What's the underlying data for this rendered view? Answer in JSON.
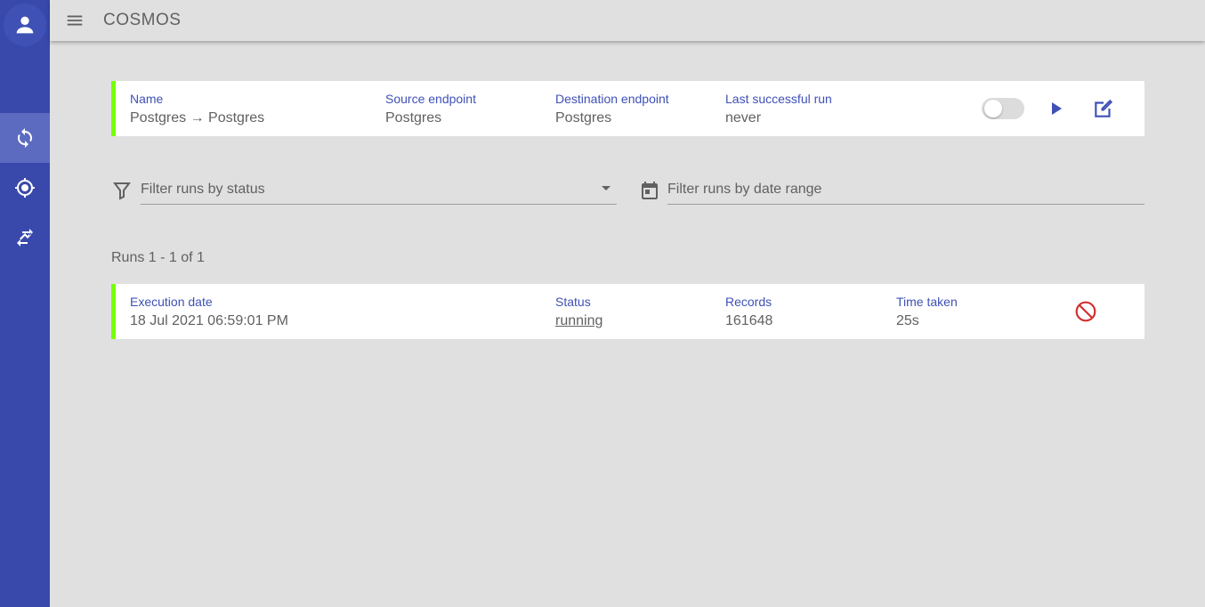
{
  "app": {
    "title": "COSMOS"
  },
  "sidebar": {
    "items": [
      {
        "name": "sync",
        "icon": "sync-icon",
        "active": true
      },
      {
        "name": "crosshair",
        "icon": "crosshair-icon",
        "active": false
      },
      {
        "name": "transfer",
        "icon": "transfer-icon",
        "active": false
      }
    ]
  },
  "transfer": {
    "name_label": "Name",
    "name_value": "Postgres → Postgres",
    "source_label": "Source endpoint",
    "source_value": "Postgres",
    "destination_label": "Destination endpoint",
    "destination_value": "Postgres",
    "last_run_label": "Last successful run",
    "last_run_value": "never",
    "enabled": false
  },
  "filters": {
    "status_placeholder": "Filter runs by status",
    "date_placeholder": "Filter runs by date range"
  },
  "runs": {
    "count_text": "Runs 1 - 1 of 1",
    "headers": {
      "execution_date": "Execution date",
      "status": "Status",
      "records": "Records",
      "time_taken": "Time taken"
    },
    "rows": [
      {
        "execution_date": "18 Jul 2021 06:59:01 PM",
        "status": "running",
        "records": "161648",
        "time_taken": "25s"
      }
    ]
  },
  "colors": {
    "sidebar": "#3949ab",
    "accent": "#3f51b5",
    "status_bar": "#76ff03",
    "cancel": "#d32f2f",
    "background": "#e0e0e0"
  }
}
